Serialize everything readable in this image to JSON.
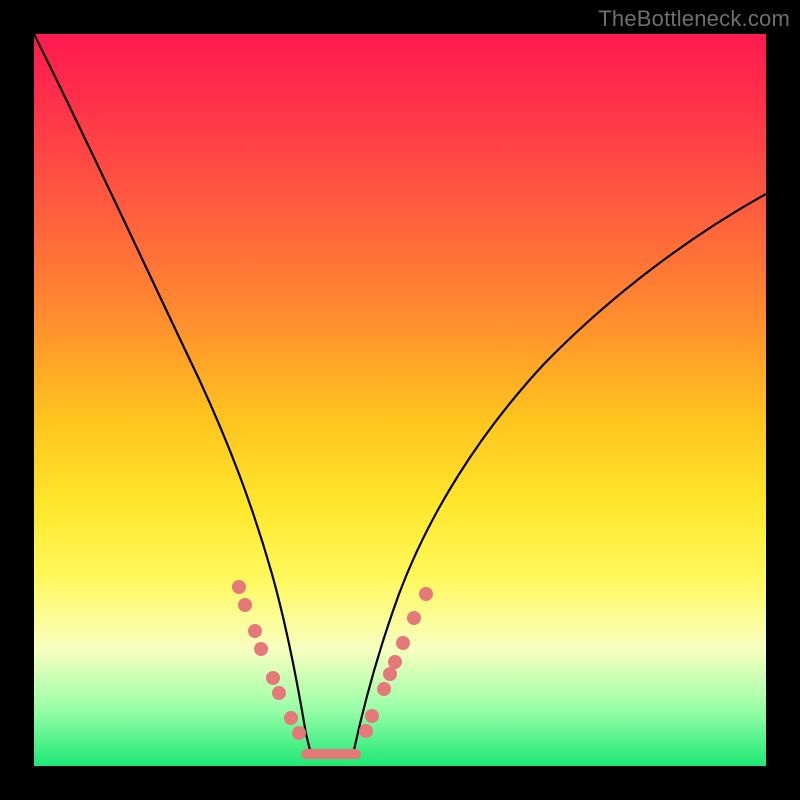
{
  "watermark": "TheBottleneck.com",
  "chart_data": {
    "type": "line",
    "title": "",
    "xlabel": "",
    "ylabel": "",
    "xlim": [
      0,
      100
    ],
    "ylim": [
      0,
      100
    ],
    "grid": false,
    "legend": false,
    "background_gradient": {
      "direction": "vertical",
      "stops": [
        {
          "pos": 0,
          "color": "#ff1a4f"
        },
        {
          "pos": 22,
          "color": "#ff5740"
        },
        {
          "pos": 52,
          "color": "#ffc21f"
        },
        {
          "pos": 74,
          "color": "#fff85a"
        },
        {
          "pos": 92,
          "color": "#9cffa8"
        },
        {
          "pos": 100,
          "color": "#1de876"
        }
      ]
    },
    "series": [
      {
        "name": "left-curve",
        "x": [
          0,
          5,
          10,
          15,
          20,
          24,
          28,
          31,
          33,
          35,
          37.5
        ],
        "y": [
          100,
          87,
          73,
          59,
          45,
          33,
          23,
          15,
          10,
          6,
          2
        ]
      },
      {
        "name": "right-curve",
        "x": [
          44,
          46,
          48,
          50,
          53,
          57,
          62,
          68,
          75,
          83,
          92,
          100
        ],
        "y": [
          2,
          6,
          10,
          14,
          20,
          27,
          34,
          41,
          48,
          55,
          62,
          68
        ]
      }
    ],
    "trough": {
      "x_start": 37.5,
      "x_end": 44,
      "y": 1.5
    },
    "markers_left": [
      {
        "x": 28.0,
        "y": 24.5
      },
      {
        "x": 28.9,
        "y": 22.0
      },
      {
        "x": 30.2,
        "y": 18.5
      },
      {
        "x": 31.0,
        "y": 16.0
      },
      {
        "x": 32.6,
        "y": 12.0
      },
      {
        "x": 33.5,
        "y": 10.0
      },
      {
        "x": 35.2,
        "y": 6.5
      },
      {
        "x": 36.2,
        "y": 4.5
      }
    ],
    "markers_right": [
      {
        "x": 45.3,
        "y": 4.8
      },
      {
        "x": 46.2,
        "y": 6.8
      },
      {
        "x": 47.8,
        "y": 10.5
      },
      {
        "x": 48.6,
        "y": 12.5
      },
      {
        "x": 49.3,
        "y": 14.2
      },
      {
        "x": 50.4,
        "y": 16.8
      },
      {
        "x": 51.9,
        "y": 20.2
      },
      {
        "x": 53.5,
        "y": 23.5
      }
    ],
    "marker_color": "#e57979",
    "curve_color": "#000000"
  }
}
